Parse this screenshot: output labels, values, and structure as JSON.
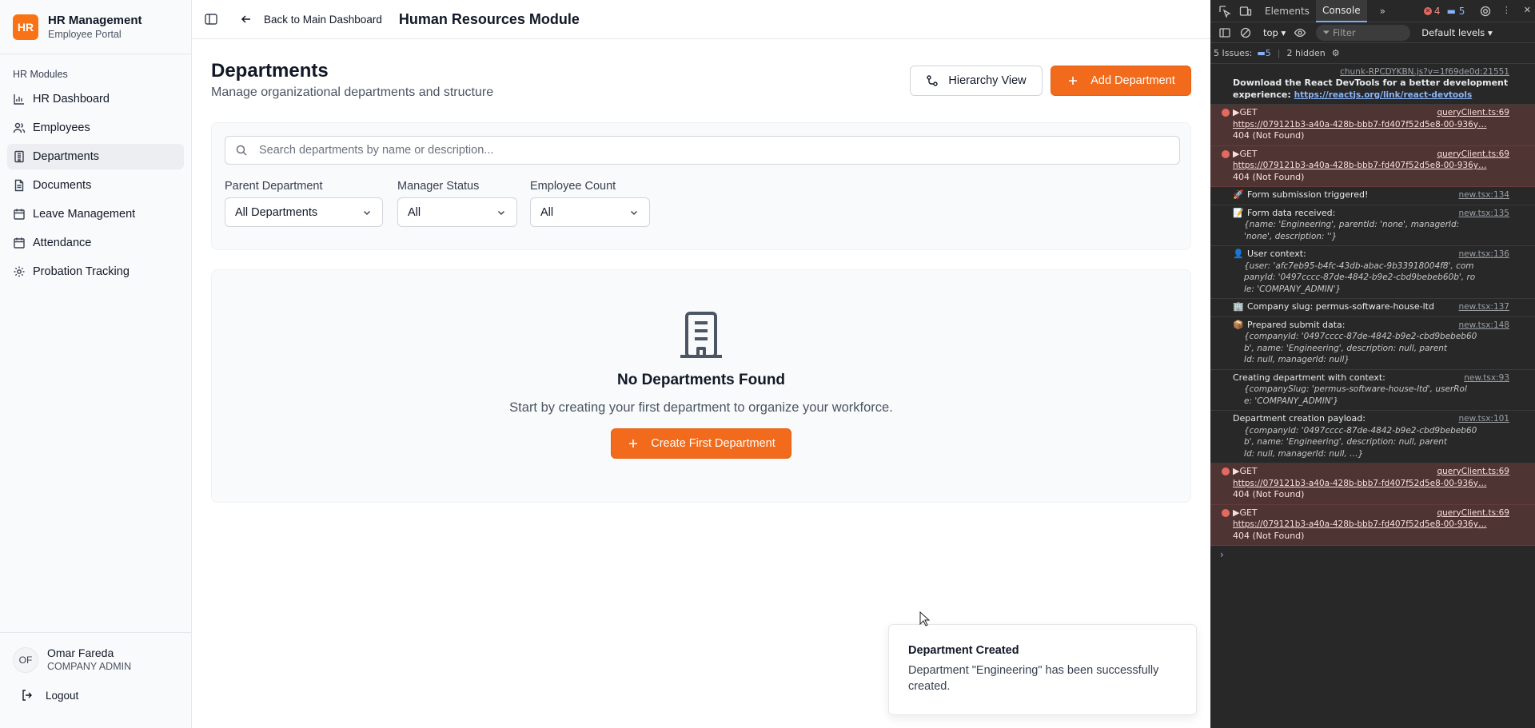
{
  "brand": {
    "logo": "HR",
    "title": "HR Management",
    "subtitle": "Employee Portal"
  },
  "sidebar": {
    "section_label": "HR Modules",
    "items": [
      {
        "label": "HR Dashboard",
        "icon": "bar-chart-icon"
      },
      {
        "label": "Employees",
        "icon": "users-icon"
      },
      {
        "label": "Departments",
        "icon": "building-icon",
        "active": true
      },
      {
        "label": "Documents",
        "icon": "file-icon"
      },
      {
        "label": "Leave Management",
        "icon": "calendar-icon"
      },
      {
        "label": "Attendance",
        "icon": "calendar-icon"
      },
      {
        "label": "Probation Tracking",
        "icon": "gear-icon"
      }
    ],
    "user": {
      "initials": "OF",
      "name": "Omar Fareda",
      "role": "COMPANY ADMIN"
    },
    "logout_label": "Logout"
  },
  "header": {
    "back_label": "Back to Main Dashboard",
    "module_title": "Human Resources Module"
  },
  "page": {
    "title": "Departments",
    "subtitle": "Manage organizational departments and structure",
    "hierarchy_button": "Hierarchy View",
    "add_button": "Add Department"
  },
  "search": {
    "placeholder": "Search departments by name or description..."
  },
  "filters": [
    {
      "label": "Parent Department",
      "value": "All Departments"
    },
    {
      "label": "Manager Status",
      "value": "All"
    },
    {
      "label": "Employee Count",
      "value": "All"
    }
  ],
  "empty_state": {
    "title": "No Departments Found",
    "message": "Start by creating your first department to organize your workforce.",
    "button": "Create First Department"
  },
  "toast": {
    "title": "Department Created",
    "message": "Department \"Engineering\" has been successfully created."
  },
  "colors": {
    "accent": "#f26a1b",
    "sidebar_bg": "#f9fafb",
    "devtools_bg": "#282828"
  },
  "devtools": {
    "tabs": [
      "Elements",
      "Console"
    ],
    "active_tab": "Console",
    "error_count": "4",
    "info_count": "5",
    "context": "top ▾",
    "filter_placeholder": "Filter",
    "levels": "Default levels ▾",
    "issues_label": "5 Issues:",
    "issues_count": "5",
    "hidden_label": "2 hidden",
    "logs": [
      {
        "type": "info",
        "src": "chunk-RPCDYKBN.js?v=1f69de0d:21551",
        "text": "Download the React DevTools for a better development experience: ",
        "link": "https://reactjs.org/link/react-devtools"
      },
      {
        "type": "error",
        "src": "queryClient.ts:69",
        "text": "▶GET",
        "link": "https://079121b3-a40a-428b-bbb7-fd407f52d5e8-00-936y…",
        "status": "404 (Not Found)"
      },
      {
        "type": "error",
        "src": "queryClient.ts:69",
        "text": "▶GET",
        "link": "https://079121b3-a40a-428b-bbb7-fd407f52d5e8-00-936y…",
        "status": "404 (Not Found)"
      },
      {
        "type": "log",
        "emoji": "🚀",
        "src": "new.tsx:134",
        "text": "Form submission triggered!"
      },
      {
        "type": "log",
        "emoji": "📝",
        "src": "new.tsx:135",
        "text": "Form data received:",
        "obj": "{name: 'Engineering', parentId: 'none', managerId:\n'none', description: ''}"
      },
      {
        "type": "log",
        "emoji": "👤",
        "src": "new.tsx:136",
        "text": "User context:",
        "obj": "{user: 'afc7eb95-b4fc-43db-abac-9b33918004f8', com\npanyId: '0497cccc-87de-4842-b9e2-cbd9bebeb60b', ro\nle: 'COMPANY_ADMIN'}"
      },
      {
        "type": "log",
        "emoji": "🏢",
        "src": "new.tsx:137",
        "text": "Company slug: permus-software-house-ltd"
      },
      {
        "type": "log",
        "emoji": "📦",
        "src": "new.tsx:148",
        "text": "Prepared submit data:",
        "obj": "{companyId: '0497cccc-87de-4842-b9e2-cbd9bebeb60\nb', name: 'Engineering', description: null, parent\nId: null, managerId: null}"
      },
      {
        "type": "log",
        "src": "new.tsx:93",
        "text": "Creating department with context:",
        "obj": "{companySlug: 'permus-software-house-ltd', userRol\ne: 'COMPANY_ADMIN'}"
      },
      {
        "type": "log",
        "src": "new.tsx:101",
        "text": "Department creation payload:",
        "obj": "{companyId: '0497cccc-87de-4842-b9e2-cbd9bebeb60\nb', name: 'Engineering', description: null, parent\nId: null, managerId: null, …}"
      },
      {
        "type": "error",
        "src": "queryClient.ts:69",
        "text": "▶GET",
        "link": "https://079121b3-a40a-428b-bbb7-fd407f52d5e8-00-936y…",
        "status": "404 (Not Found)"
      },
      {
        "type": "error",
        "src": "queryClient.ts:69",
        "text": "▶GET",
        "link": "https://079121b3-a40a-428b-bbb7-fd407f52d5e8-00-936y…",
        "status": "404 (Not Found)"
      }
    ]
  }
}
